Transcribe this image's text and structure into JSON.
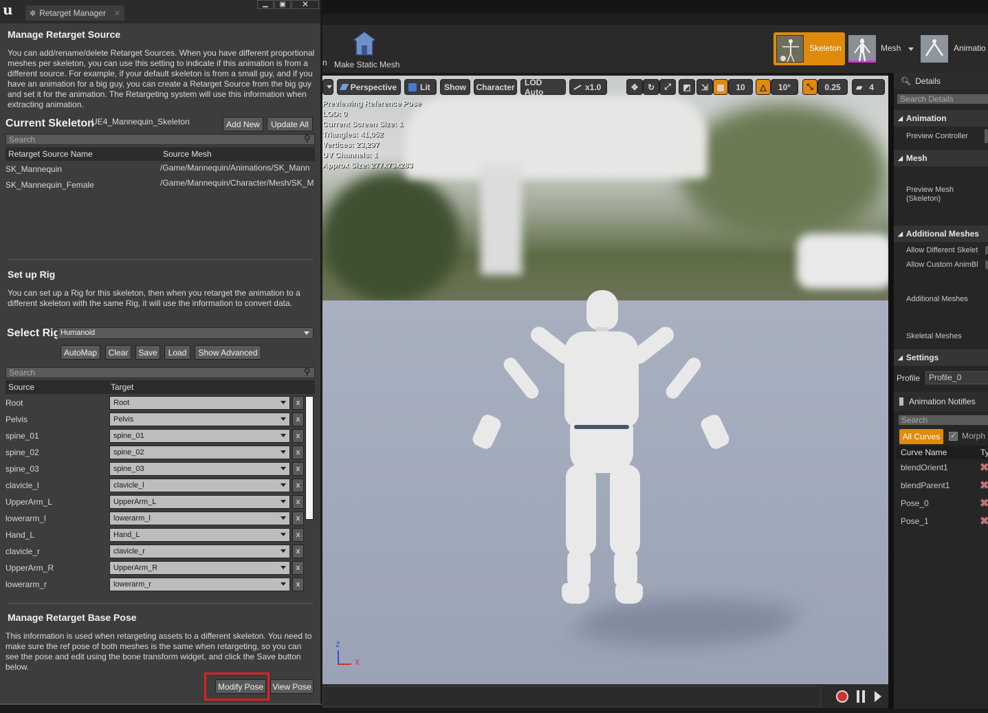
{
  "window": {
    "tab_title": "Retarget Manager",
    "controls": [
      "minimize",
      "maximize",
      "close"
    ]
  },
  "retarget_source": {
    "title": "Manage Retarget Source",
    "description": "You can add/rename/delete Retarget Sources. When you have different proportional meshes per skeleton, you can use this setting to indicate if this animation is from a different source. For example, if your default skeleton is from a small guy, and if you have an animation for a big guy, you can create a Retarget Source from the big guy and set it for the animation. The Retargeting system will use this information when extracting animation.",
    "current_skeleton_label": "Current Skeleton",
    "current_skeleton_value": "UE4_Mannequin_Skeleton",
    "add_new": "Add New",
    "update_all": "Update All",
    "search_placeholder": "Search",
    "columns": [
      "Retarget Source Name",
      "Source Mesh"
    ],
    "rows": [
      {
        "name": "SK_Mannequin",
        "mesh": "/Game/Mannequin/Animations/SK_Mann"
      },
      {
        "name": "SK_Mannequin_Female",
        "mesh": "/Game/Mannequin/Character/Mesh/SK_M"
      }
    ]
  },
  "rig": {
    "title": "Set up Rig",
    "description": "You can set up a Rig for this skeleton, then when you retarget the animation to a different skeleton with the same Rig, it will use the information to convert data.",
    "select_rig_label": "Select Rig",
    "selected_rig": "Humanoid",
    "buttons": {
      "automap": "AutoMap",
      "clear": "Clear",
      "save": "Save",
      "load": "Load",
      "show_advanced": "Show Advanced"
    },
    "search_placeholder": "Search",
    "columns": [
      "Source",
      "Target"
    ],
    "rows": [
      {
        "source": "Root",
        "target": "Root"
      },
      {
        "source": "Pelvis",
        "target": "Pelvis"
      },
      {
        "source": "spine_01",
        "target": "spine_01"
      },
      {
        "source": "spine_02",
        "target": "spine_02"
      },
      {
        "source": "spine_03",
        "target": "spine_03"
      },
      {
        "source": "clavicle_l",
        "target": "clavicle_l"
      },
      {
        "source": "UpperArm_L",
        "target": "UpperArm_L"
      },
      {
        "source": "lowerarm_l",
        "target": "lowerarm_l"
      },
      {
        "source": "Hand_L",
        "target": "Hand_L"
      },
      {
        "source": "clavicle_r",
        "target": "clavicle_r"
      },
      {
        "source": "UpperArm_R",
        "target": "UpperArm_R"
      },
      {
        "source": "lowerarm_r",
        "target": "lowerarm_r"
      }
    ],
    "clear_label": "x"
  },
  "base_pose": {
    "title": "Manage Retarget Base Pose",
    "description": "This information is used when retargeting assets to a different skeleton. You need to make sure the ref pose of both meshes is the same when retargeting, so you can see the pose and edit using the bone transform widget, and click the Save button below.",
    "modify_pose": "Modify Pose",
    "view_pose": "View Pose"
  },
  "toolbar": {
    "make_static_mesh": "Make Static Mesh",
    "cut_text": "n",
    "modes": [
      {
        "label": "Skeleton",
        "active": true
      },
      {
        "label": "Mesh",
        "active": false
      },
      {
        "label": "Animatio",
        "active": false
      }
    ]
  },
  "viewport": {
    "buttons": {
      "perspective": "Perspective",
      "lit": "Lit",
      "show": "Show",
      "character": "Character",
      "lod": "LOD Auto",
      "speed": "x1.0",
      "grid_snap": "10",
      "rot_snap": "10°",
      "scale_snap": "0.25",
      "cam_speed": "4"
    },
    "info_lines": [
      "Previewing Reference Pose",
      "LOD: 0",
      "Current Screen Size: 1",
      "Triangles: 41,052",
      "Vertices: 23,297",
      "UV Channels: 1",
      "Approx Size: 277x73x283"
    ],
    "axis_z": "Z",
    "axis_x": "X"
  },
  "details": {
    "tab": "Details",
    "search_placeholder": "Search Details",
    "sections": {
      "animation": "Animation",
      "mesh": "Mesh",
      "additional_meshes": "Additional Meshes",
      "settings": "Settings"
    },
    "preview_controller": "Preview Controller",
    "preview_mesh": "Preview Mesh\n(Skeleton)",
    "allow_diff_skel": "Allow Different Skelet",
    "allow_custom_anim": "Allow Custom AnimBl",
    "additional_meshes_row": "Additional Meshes",
    "skeletal_meshes": "Skeletal Meshes",
    "profile_label": "Profile",
    "profile_value": "Profile_0",
    "anim_notifies_tab": "Animation Notifies",
    "notifies_search": "Search",
    "all_curves": "All Curves",
    "morph": "Morph",
    "curve_col": "Curve Name",
    "type_col": "Typ",
    "curves": [
      "blendOrient1",
      "blendParent1",
      "Pose_0",
      "Pose_1"
    ]
  },
  "colors": {
    "accent_orange": "#e08a0b",
    "highlight_red": "#e02020"
  }
}
